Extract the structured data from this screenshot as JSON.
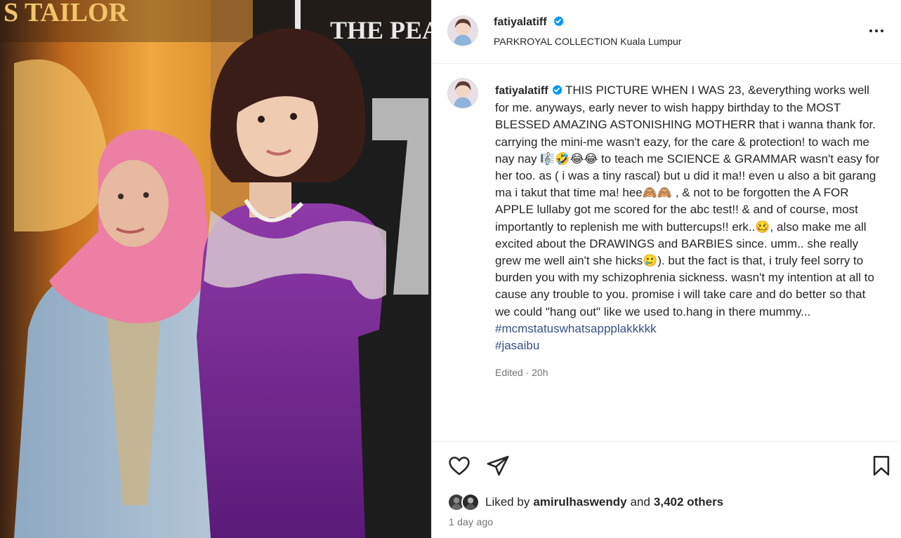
{
  "photo": {
    "background_sign_text": "THE PEA",
    "background_sign_text_left": "S TAILOR",
    "icon": "photo"
  },
  "post": {
    "username": "fatiyalatiff",
    "verified_icon": "verified-badge-icon",
    "location": "PARKROYAL COLLECTION Kuala Lumpur",
    "more_icon": "more-options-icon"
  },
  "caption": {
    "username": "fatiyalatiff",
    "text": "THIS PICTURE WHEN I WAS 23, &everything works well for me. anyways, early never to wish happy birthday to the MOST BLESSED AMAZING ASTONISHING MOTHERR that i wanna thank for. carrying the mini-me wasn't eazy, for the care & protection! to wach me nay nay 🎼🤣😂😂 to teach me SCIENCE & GRAMMAR wasn't easy for her too. as ( i was a tiny rascal) but u did it ma!! even u also a bit garang ma i takut that time ma! hee🙈🙈 , & not to be forgotten the A FOR APPLE lullaby got me scored for the abc test!! & and of course, most importantly to replenish me with buttercups!! erk..🥴, also make me all excited about the DRAWINGS and BARBIES since. umm.. she really grew me well ain't she hicks🥲). but the fact is that, i truly feel sorry to burden you with my schizophrenia sickness. wasn't my intention at all to cause any trouble to you. promise i will take care and do better so that we could \"hang out\" like we used to.hang in there mummy...",
    "hashtags": [
      "#mcmstatuswhatsappplakkkkk",
      "#jasaibu"
    ],
    "edited": "Edited · 20h"
  },
  "actions": {
    "like_icon": "heart-icon",
    "share_icon": "paper-plane-icon",
    "save_icon": "bookmark-icon"
  },
  "likes": {
    "prefix": "Liked by",
    "liker": "amirulhaswendy",
    "and": "and",
    "others": "3,402 others"
  },
  "timestamp": "1 day ago",
  "colors": {
    "verified_blue": "#0095f6",
    "hashtag_blue": "#385185",
    "muted_text": "#737373",
    "divider": "#efefef"
  }
}
